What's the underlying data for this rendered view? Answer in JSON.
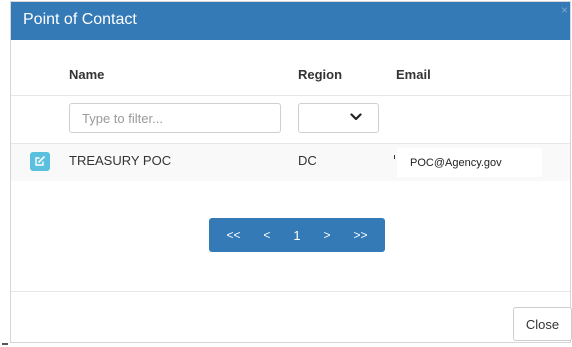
{
  "dialog": {
    "title": "Point of Contact",
    "close_glyph": "×"
  },
  "table": {
    "columns": [
      "Name",
      "Region",
      "Email"
    ],
    "filter": {
      "placeholder": "Type to filter...",
      "value": ""
    },
    "region_select": {
      "selected": "",
      "icon": "chevron-down-icon"
    },
    "rows": [
      {
        "edit_icon": "edit-icon",
        "name": "TREASURY POC",
        "region": "DC",
        "email": "POC@Agency.gov"
      }
    ]
  },
  "pagination": {
    "first": "<<",
    "prev": "<",
    "current": "1",
    "next": ">",
    "last": ">>"
  },
  "footer": {
    "close_label": "Close"
  },
  "colors": {
    "header_bg": "#337ab7",
    "edit_button": "#5bc0de",
    "pager_bg": "#337ab7"
  }
}
